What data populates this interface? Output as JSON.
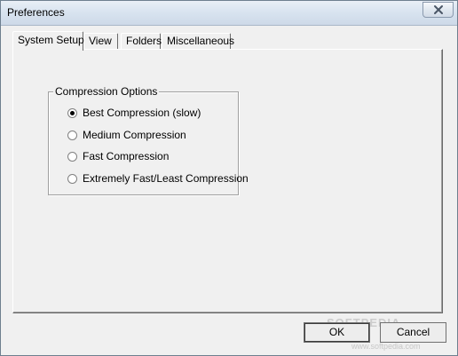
{
  "window": {
    "title": "Preferences"
  },
  "tabs": [
    {
      "label": "System Setup",
      "active": true
    },
    {
      "label": "View",
      "active": false
    },
    {
      "label": "Folders",
      "active": false
    },
    {
      "label": "Miscellaneous",
      "active": false
    }
  ],
  "compression": {
    "group_title": "Compression Options",
    "options": [
      {
        "label": "Best Compression (slow)",
        "checked": true
      },
      {
        "label": "Medium Compression",
        "checked": false
      },
      {
        "label": "Fast Compression",
        "checked": false
      },
      {
        "label": "Extremely Fast/Least Compression",
        "checked": false
      }
    ]
  },
  "buttons": {
    "ok_label": "OK",
    "cancel_label": "Cancel"
  },
  "watermark": {
    "brand": "SOFTPEDIA",
    "url": "www.softpedia.com"
  },
  "icons": {
    "close": "close-icon",
    "radio": "radio-button"
  }
}
